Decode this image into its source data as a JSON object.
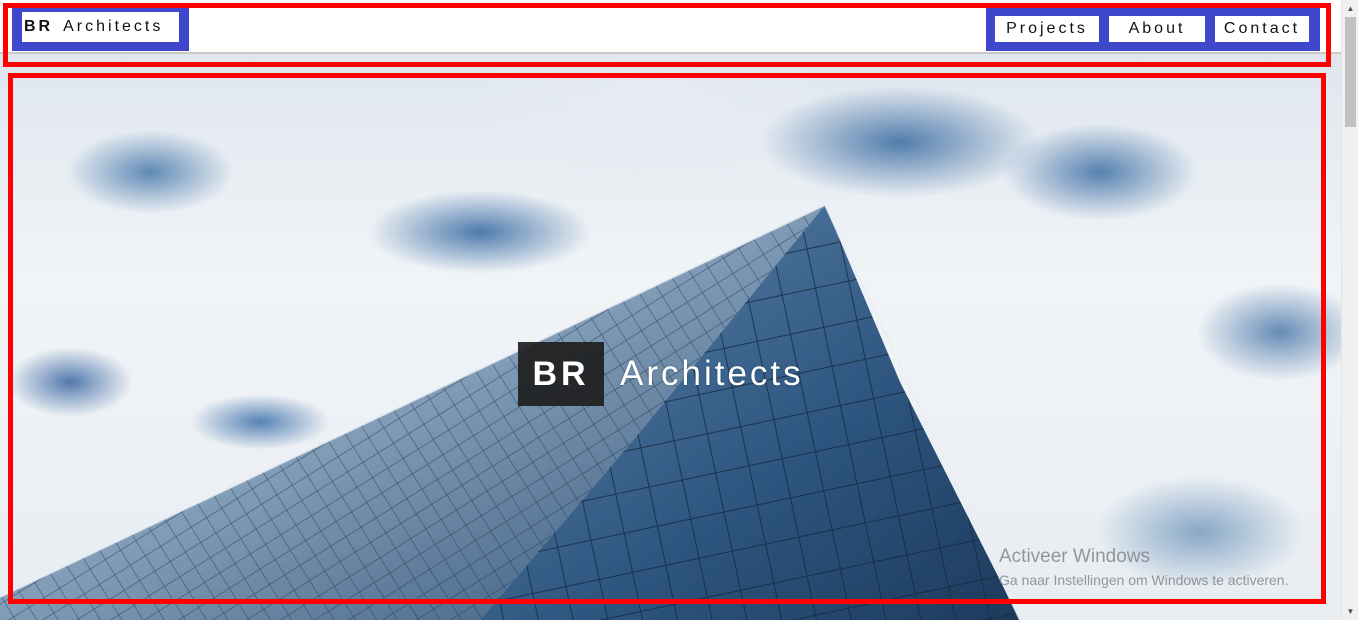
{
  "header": {
    "logo": {
      "bold": "BR",
      "name": "Architects"
    },
    "nav": [
      {
        "label": "Projects"
      },
      {
        "label": "About"
      },
      {
        "label": "Contact"
      }
    ]
  },
  "hero": {
    "title_bold": "BR",
    "title_name": "Architects"
  },
  "watermark": {
    "title": "Activeer Windows",
    "subtitle": "Ga naar Instellingen om Windows te activeren."
  },
  "colors": {
    "nav_highlight": "#3f48cc",
    "outline": "#ff0000",
    "hero_badge": "#1e1e1e"
  },
  "icons": {
    "scroll_up": "triangle-up",
    "scroll_down": "triangle-down"
  }
}
